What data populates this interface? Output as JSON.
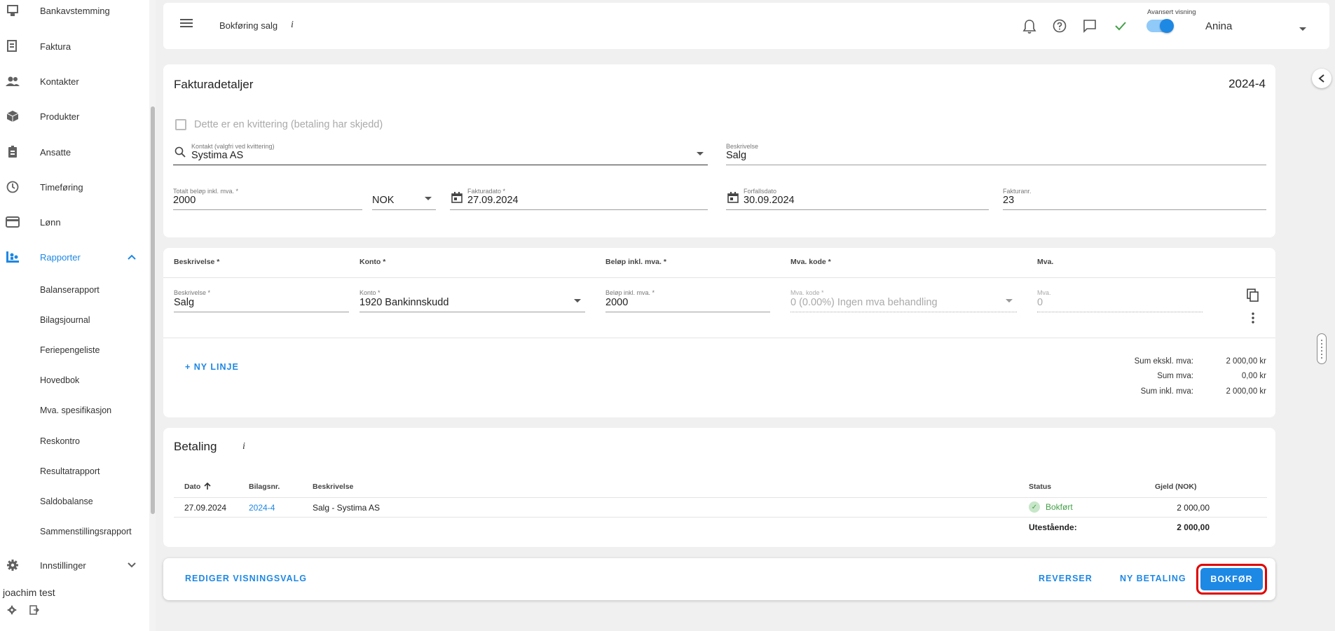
{
  "sidebar": {
    "nav": [
      {
        "label": "Bankavstemming",
        "icon": "bank-reconcile-icon"
      },
      {
        "label": "Faktura",
        "icon": "invoice-icon"
      },
      {
        "label": "Kontakter",
        "icon": "contacts-icon"
      },
      {
        "label": "Produkter",
        "icon": "box-icon"
      },
      {
        "label": "Ansatte",
        "icon": "badge-icon"
      },
      {
        "label": "Timeføring",
        "icon": "clock-icon"
      },
      {
        "label": "Lønn",
        "icon": "card-icon"
      },
      {
        "label": "Rapporter",
        "icon": "reports-icon"
      }
    ],
    "reports_sub": [
      "Balanserapport",
      "Bilagsjournal",
      "Feriepengeliste",
      "Hovedbok",
      "Mva. spesifikasjon",
      "Reskontro",
      "Resultatrapport",
      "Saldobalanse",
      "Sammenstillingsrapport"
    ],
    "settings_label": "Innstillinger",
    "user_name": "joachim test"
  },
  "topbar": {
    "title": "Bokføring salg",
    "info": "i",
    "advanced_label": "Avansert visning",
    "user": "Anina"
  },
  "invoice": {
    "title": "Fakturadetaljer",
    "number": "2024-4",
    "receipt_label": "Dette er en kvittering (betaling har skjedd)",
    "contact_label": "Kontakt (valgfri ved kvittering)",
    "contact_value": "Systima AS",
    "description_label": "Beskrivelse",
    "description_value": "Salg",
    "total_label": "Totalt beløp inkl. mva. *",
    "total_value": "2000",
    "currency": "NOK",
    "invoice_date_label": "Fakturadato *",
    "invoice_date": "27.09.2024",
    "due_date_label": "Forfallsdato",
    "due_date": "30.09.2024",
    "invoice_nr_label": "Fakturanr.",
    "invoice_nr": "23"
  },
  "lines": {
    "headers": [
      "Beskrivelse *",
      "Konto *",
      "Beløp inkl. mva. *",
      "Mva. kode *",
      "Mva."
    ],
    "row": {
      "desc_label": "Beskrivelse *",
      "desc": "Salg",
      "account_label": "Konto *",
      "account": "1920 Bankinnskudd",
      "amount_label": "Beløp inkl. mva. *",
      "amount": "2000",
      "vat_code_label": "Mva. kode *",
      "vat_code": "0 (0.00%) Ingen mva behandling",
      "vat_label": "Mva.",
      "vat": "0"
    },
    "new_line": "+ NY LINJE",
    "sums": [
      {
        "label": "Sum ekskl. mva:",
        "value": "2 000,00 kr"
      },
      {
        "label": "Sum mva:",
        "value": "0,00 kr"
      },
      {
        "label": "Sum inkl. mva:",
        "value": "2 000,00 kr"
      }
    ]
  },
  "payment": {
    "title": "Betaling",
    "info": "i",
    "headers": {
      "date": "Dato",
      "voucher": "Bilagsnr.",
      "desc": "Beskrivelse",
      "status": "Status",
      "debt": "Gjeld (NOK)"
    },
    "row": {
      "date": "27.09.2024",
      "voucher": "2024-4",
      "desc": "Salg - Systima AS",
      "status": "Bokført",
      "debt": "2 000,00"
    },
    "outstanding_label": "Utestående:",
    "outstanding_value": "2 000,00"
  },
  "actions": {
    "edit_view": "REDIGER VISNINGSVALG",
    "reverse": "REVERSER",
    "new_payment": "NY BETALING",
    "post": "BOKFØR"
  },
  "colors": {
    "accent": "#1e88e5",
    "success": "#43a047",
    "highlight": "#e00000"
  }
}
